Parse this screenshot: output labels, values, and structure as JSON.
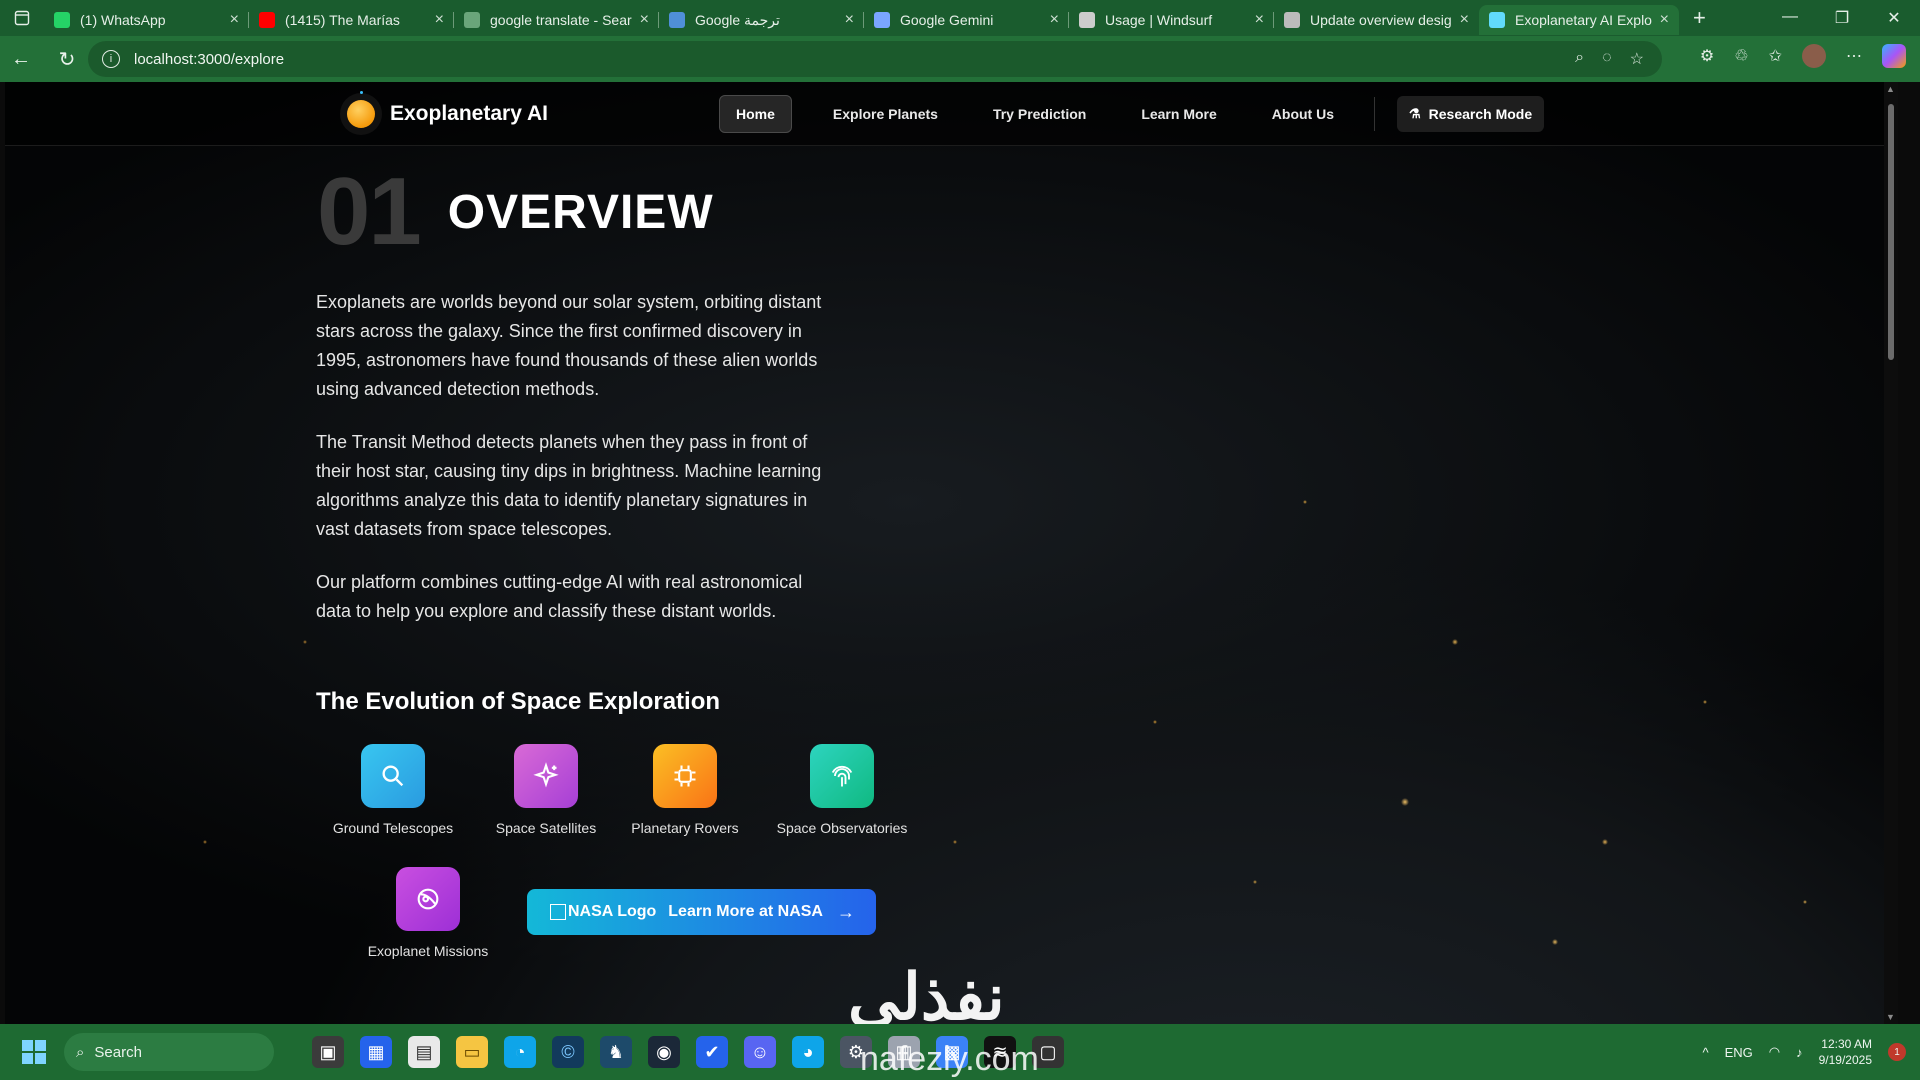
{
  "browser": {
    "tabs": [
      {
        "title": "(1) WhatsApp",
        "icon": "whatsapp-icon",
        "color": "#25d366"
      },
      {
        "title": "(1415) The Marías",
        "icon": "youtube-icon",
        "color": "#ff0000"
      },
      {
        "title": "google translate - Sear",
        "icon": "search-icon",
        "color": "#6aa57a"
      },
      {
        "title": "Google ترجمة",
        "icon": "translate-icon",
        "color": "#4f8fd8"
      },
      {
        "title": "Google Gemini",
        "icon": "gemini-icon",
        "color": "#7aa6ff"
      },
      {
        "title": "Usage | Windsurf",
        "icon": "windsurf-icon",
        "color": "#cccccc"
      },
      {
        "title": "Update overview desig",
        "icon": "openai-icon",
        "color": "#bbbbbb"
      },
      {
        "title": "Exoplanetary AI Explor",
        "icon": "react-icon",
        "color": "#61dafb",
        "active": true
      }
    ],
    "url": "localhost:3000/explore"
  },
  "site": {
    "brand": "Exoplanetary AI",
    "nav": [
      "Home",
      "Explore Planets",
      "Try Prediction",
      "Learn More",
      "About Us"
    ],
    "research_button": "Research Mode"
  },
  "overview": {
    "number": "01",
    "title": "OVERVIEW",
    "paragraphs": [
      "Exoplanets are worlds beyond our solar system, orbiting distant stars across the galaxy. Since the first confirmed discovery in 1995, astronomers have found thousands of these alien worlds using advanced detection methods.",
      "The Transit Method detects planets when they pass in front of their host star, causing tiny dips in brightness. Machine learning algorithms analyze this data to identify planetary signatures in vast datasets from space telescopes.",
      "Our platform combines cutting-edge AI with real astronomical data to help you explore and classify these distant worlds."
    ],
    "subheading": "The Evolution of Space Exploration",
    "features": [
      {
        "label": "Ground Telescopes",
        "icon": "search-icon",
        "color": "#2fb6e8"
      },
      {
        "label": "Space Satellites",
        "icon": "sparkles-icon",
        "color": "#c04fd6"
      },
      {
        "label": "Planetary Rovers",
        "icon": "chip-icon",
        "color": "#f59e0b"
      },
      {
        "label": "Space Observatories",
        "icon": "fingerprint-icon",
        "color": "#1cc7a3"
      },
      {
        "label": "Exoplanet Missions",
        "icon": "orbit-icon",
        "color": "#b83fd9"
      }
    ],
    "nasa_button": {
      "img_alt": "NASA Logo",
      "label": "Learn More at NASA"
    }
  },
  "watermark": {
    "arabic": "نفذلي",
    "latin": "nafezly.com"
  },
  "taskbar": {
    "search": "Search",
    "lang": "ENG",
    "time": "12:30 AM",
    "date": "9/19/2025",
    "notifications": "1"
  }
}
